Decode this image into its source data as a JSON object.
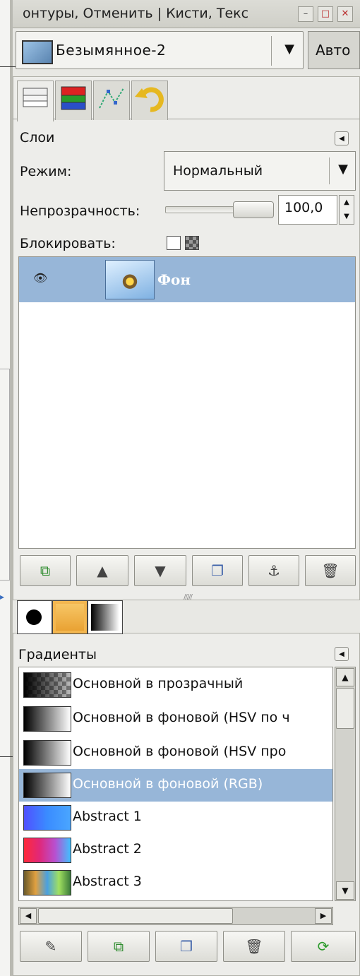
{
  "window": {
    "title": "онтуры, Отменить | Кисти, Текс"
  },
  "image_selector": {
    "name": "Безымянное-2",
    "auto_label": "Авто"
  },
  "layers": {
    "panel_title": "Слои",
    "mode_label": "Режим:",
    "mode_value": "Нормальный",
    "opacity_label": "Непрозрачность:",
    "opacity_value": "100,0",
    "opacity_percent": 100,
    "lock_label": "Блокировать:",
    "items": [
      {
        "name": "Фон",
        "visible": true,
        "selected": true
      }
    ]
  },
  "gradients": {
    "panel_title": "Градиенты",
    "items": [
      {
        "name": "Основной в прозрачный",
        "selected": false
      },
      {
        "name": "Основной в фоновой (HSV по ч",
        "selected": false
      },
      {
        "name": "Основной в фоновой  (HSV про",
        "selected": false
      },
      {
        "name": "Основной в фоновой (RGB)",
        "selected": true
      },
      {
        "name": "Abstract 1",
        "selected": false
      },
      {
        "name": "Abstract 2",
        "selected": false
      },
      {
        "name": "Abstract 3",
        "selected": false
      }
    ]
  },
  "colors": {
    "selection": "#97b6d8",
    "background": "#ededea"
  }
}
